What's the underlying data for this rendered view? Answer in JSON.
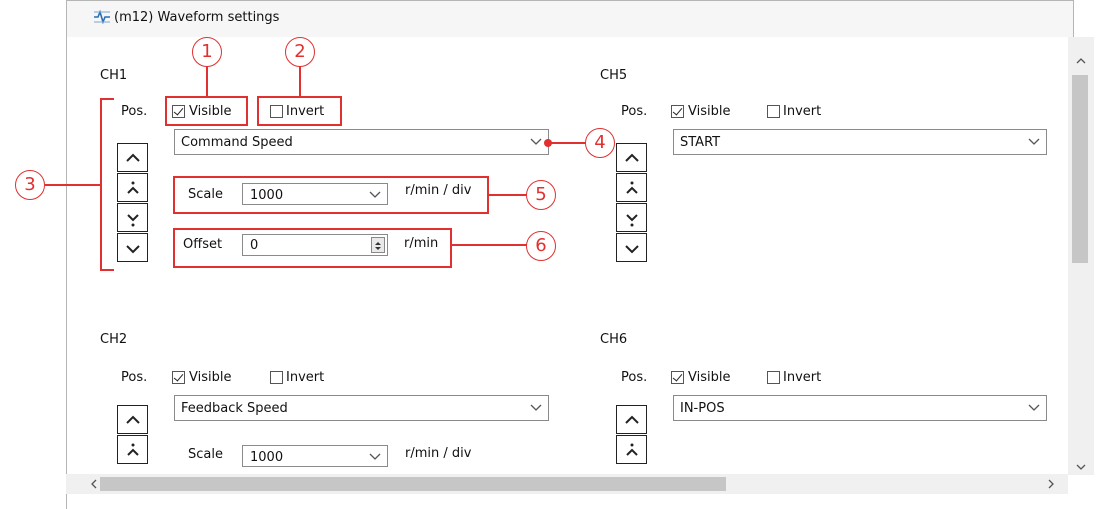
{
  "window": {
    "title": "(m12) Waveform settings",
    "icon": "waveform-settings-icon"
  },
  "common": {
    "pos_label": "Pos.",
    "visible_label": "Visible",
    "invert_label": "Invert",
    "scale_label": "Scale",
    "offset_label": "Offset",
    "scale_unit": "r/min / div",
    "offset_unit": "r/min"
  },
  "channels": {
    "ch1": {
      "name": "CH1",
      "visible": true,
      "invert": false,
      "signal": "Command Speed",
      "scale": "1000",
      "offset": "0"
    },
    "ch5": {
      "name": "CH5",
      "visible": true,
      "invert": false,
      "signal": "START"
    },
    "ch2": {
      "name": "CH2",
      "visible": true,
      "invert": false,
      "signal": "Feedback Speed",
      "scale": "1000"
    },
    "ch6": {
      "name": "CH6",
      "visible": true,
      "invert": false,
      "signal": "IN-POS"
    }
  },
  "callouts": [
    "1",
    "2",
    "3",
    "4",
    "5",
    "6"
  ],
  "colors": {
    "callout": "#e03030",
    "border": "#b5b5b5",
    "scroll": "#f0f0f0",
    "thumb": "#c6c6c6"
  }
}
